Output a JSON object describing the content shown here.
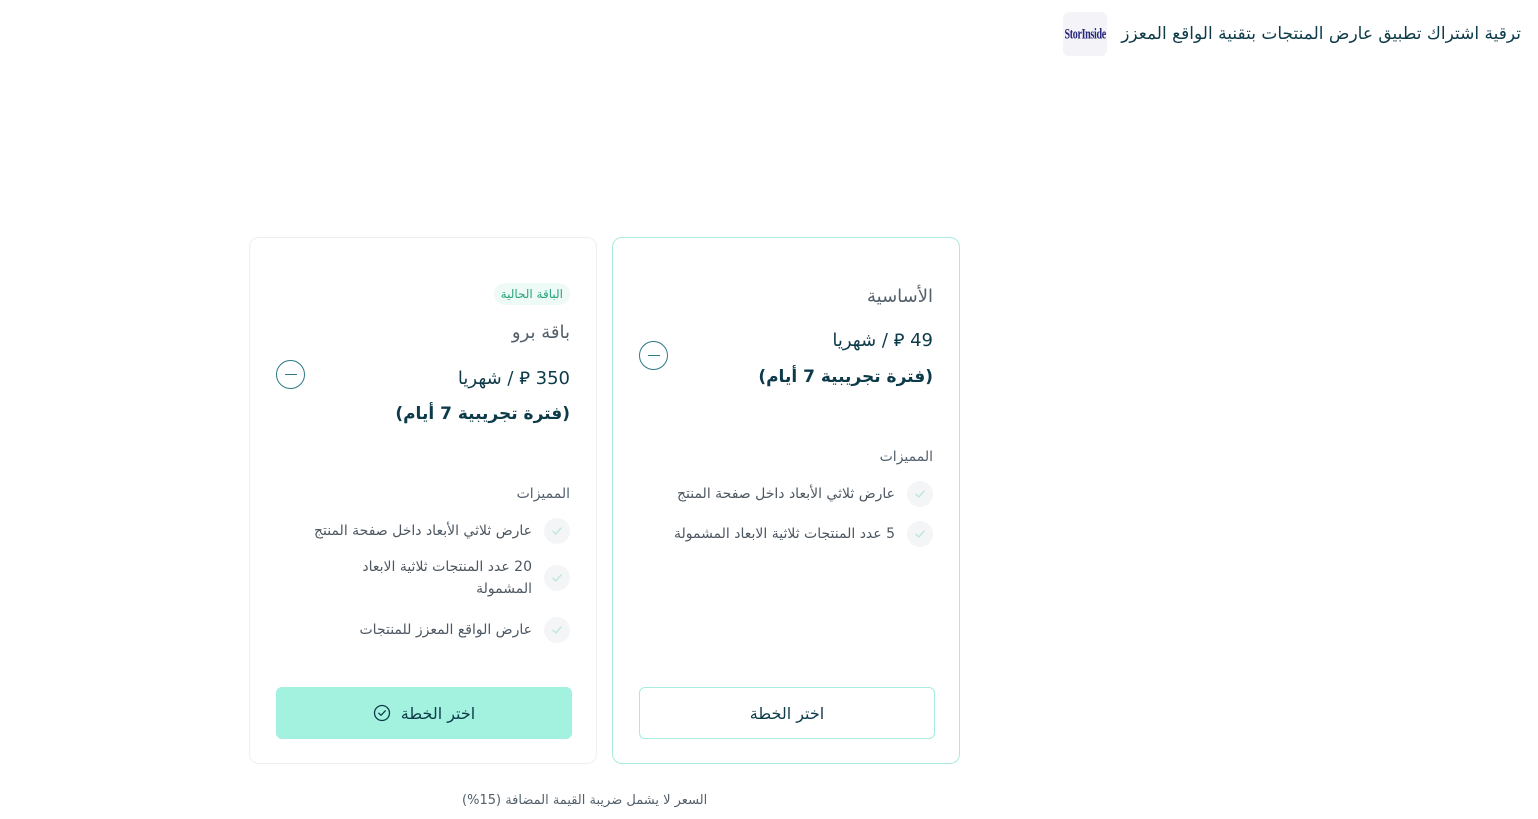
{
  "header": {
    "logo_text": "StorInside",
    "title": "ترقية اشتراك تطبيق عارض المنتجات بتقنية الواقع المعزز"
  },
  "plans": [
    {
      "badge": "الباقة الحالية",
      "name": "باقة برو",
      "price": "350 ⃁ / شهريا",
      "trial": "(فترة تجريبية 7 أيام)",
      "features_title": "المميزات",
      "features": [
        "عارض ثلاثي الأبعاد داخل صفحة المنتج",
        "20 عدد المنتجات ثلاثية الابعاد المشمولة",
        "عارض الواقع المعزز للمنتجات"
      ],
      "button_label": "اختر الخطة",
      "button_icon": "check-circle-icon"
    },
    {
      "name": "الأساسية",
      "price": "49 ⃁ / شهريا",
      "trial": "(فترة تجريبية 7 أيام)",
      "features_title": "المميزات",
      "features": [
        "عارض ثلاثي الأبعاد داخل صفحة المنتج",
        "5 عدد المنتجات ثلاثية الابعاد المشمولة"
      ],
      "button_label": "اختر الخطة"
    }
  ],
  "footer": {
    "vat_note": "السعر لا يشمل ضريبة القيمة المضافة (15%)"
  },
  "colors": {
    "accent": "#a3f2df",
    "accent_border": "#a7ecde",
    "primary_text": "#0e3b4a",
    "badge_text": "#27a47e"
  }
}
